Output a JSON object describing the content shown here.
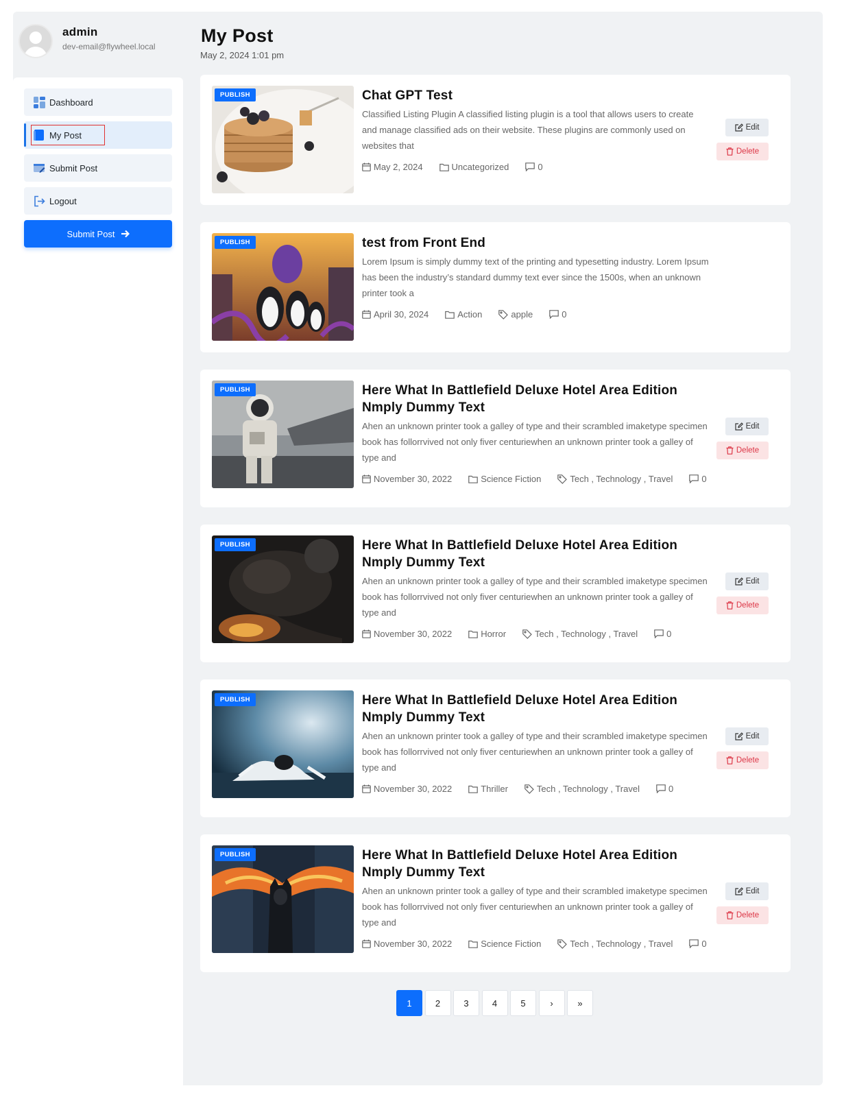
{
  "user": {
    "name": "admin",
    "email": "dev-email@flywheel.local"
  },
  "sidebar": {
    "items": [
      {
        "label": "Dashboard",
        "icon": "dashboard-icon"
      },
      {
        "label": "My Post",
        "icon": "my-post-icon",
        "active": true
      },
      {
        "label": "Submit Post",
        "icon": "submit-post-icon"
      },
      {
        "label": "Logout",
        "icon": "logout-icon"
      }
    ],
    "submit_button": "Submit Post"
  },
  "header": {
    "title": "My Post",
    "date": "May 2, 2024 1:01 pm"
  },
  "posts": [
    {
      "status": "PUBLISH",
      "title": "Chat GPT Test",
      "excerpt": "Classified Listing Plugin A classified listing plugin is a tool that allows users to create and manage classified ads on their website. These plugins are commonly used on websites that",
      "date": "May 2, 2024",
      "category": "Uncategorized",
      "tags": "",
      "comments": "0"
    },
    {
      "status": "PUBLISH",
      "title": "test from Front End",
      "excerpt": "Lorem Ipsum is simply dummy text of the printing and typesetting industry. Lorem Ipsum has been the industry’s standard dummy text ever since the 1500s, when an unknown printer took a",
      "date": "April 30, 2024",
      "category": "Action",
      "tags": "apple",
      "comments": "0"
    },
    {
      "status": "PUBLISH",
      "title": "Here What In Battlefield Deluxe Hotel Area Edition Nmply Dummy Text",
      "excerpt": "Ahen an unknown printer took a galley of type and their scrambled imaketype specimen book has follorrvived not only fiver centuriewhen an unknown printer took a galley of type and",
      "date": "November 30, 2022",
      "category": "Science Fiction",
      "tags": "Tech , Technology , Travel",
      "comments": "0"
    },
    {
      "status": "PUBLISH",
      "title": "Here What In Battlefield Deluxe Hotel Area Edition Nmply Dummy Text",
      "excerpt": "Ahen an unknown printer took a galley of type and their scrambled imaketype specimen book has follorrvived not only fiver centuriewhen an unknown printer took a galley of type and",
      "date": "November 30, 2022",
      "category": "Horror",
      "tags": "Tech , Technology , Travel",
      "comments": "0"
    },
    {
      "status": "PUBLISH",
      "title": "Here What In Battlefield Deluxe Hotel Area Edition Nmply Dummy Text",
      "excerpt": "Ahen an unknown printer took a galley of type and their scrambled imaketype specimen book has follorrvived not only fiver centuriewhen an unknown printer took a galley of type and",
      "date": "November 30, 2022",
      "category": "Thriller",
      "tags": "Tech , Technology , Travel",
      "comments": "0"
    },
    {
      "status": "PUBLISH",
      "title": "Here What In Battlefield Deluxe Hotel Area Edition Nmply Dummy Text",
      "excerpt": "Ahen an unknown printer took a galley of type and their scrambled imaketype specimen book has follorrvived not only fiver centuriewhen an unknown printer took a galley of type and",
      "date": "November 30, 2022",
      "category": "Science Fiction",
      "tags": "Tech , Technology , Travel",
      "comments": "0"
    }
  ],
  "actions": {
    "edit": "Edit",
    "delete": "Delete"
  },
  "pagination": {
    "pages": [
      "1",
      "2",
      "3",
      "4",
      "5"
    ],
    "current": "1",
    "next": "›",
    "last": "»"
  },
  "colors": {
    "primary": "#0d6efd",
    "danger": "#dc3545",
    "background": "#f0f2f4"
  }
}
